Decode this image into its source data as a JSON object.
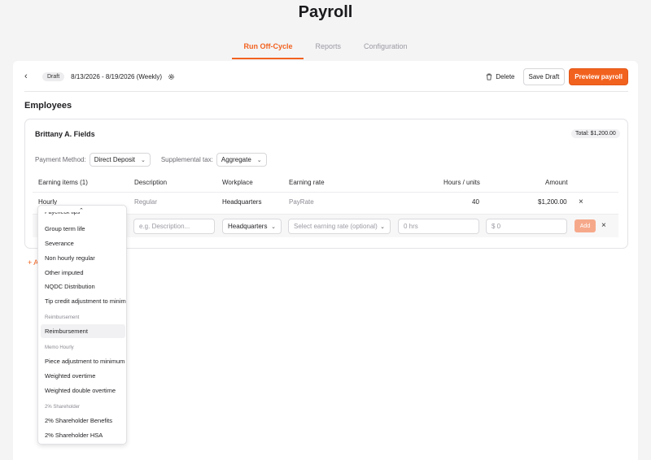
{
  "page": {
    "title": "Payroll"
  },
  "tabs": [
    {
      "label": "Run Off-Cycle"
    },
    {
      "label": "Reports"
    },
    {
      "label": "Configuration"
    }
  ],
  "toolbar": {
    "status": "Draft",
    "period": "8/13/2026 - 8/19/2026 (Weekly)",
    "delete_label": "Delete",
    "save_label": "Save Draft",
    "preview_label": "Preview payroll"
  },
  "section": {
    "title": "Employees"
  },
  "employee": {
    "name": "Brittany A. Fields",
    "total": "Total: $1,200.00",
    "payment_method_label": "Payment Method:",
    "payment_method_value": "Direct Deposit",
    "supp_tax_label": "Supplemental tax:",
    "supp_tax_value": "Aggregate"
  },
  "table": {
    "headers": [
      "Earning items (1)",
      "Description",
      "Workplace",
      "Earning rate",
      "Hours / units",
      "Amount"
    ],
    "row": {
      "item": "Hourly",
      "description": "Regular",
      "workplace": "Headquarters",
      "rate": "PayRate",
      "hours": "40",
      "amount": "$1,200.00"
    },
    "new_row": {
      "description_placeholder": "e.g. Description...",
      "workplace": "Headquarters",
      "rate_placeholder": "Select earning rate (optional)",
      "hours_placeholder": "0 hrs",
      "amount_placeholder": "$ 0",
      "add_label": "Add"
    }
  },
  "add_link": "+ A",
  "dropdown": {
    "cut_item": "Paycheck tips",
    "items_a": [
      "Group term life",
      "Severance",
      "Non hourly regular",
      "Other imputed",
      "NQDC Distribution",
      "Tip credit adjustment to minimum"
    ],
    "group_reimb": "Reimbursement",
    "item_reimb": "Reimbursement",
    "group_memo": "Memo Hourly",
    "items_memo": [
      "Piece adjustment to minimum",
      "Weighted overtime",
      "Weighted double overtime"
    ],
    "group_share": "2% Shareholder",
    "items_share": [
      "2% Shareholder Benefits",
      "2% Shareholder HSA"
    ]
  },
  "colors": {
    "accent": "#f2621f",
    "add_button": "#f6a98a"
  },
  "icons": [
    "chevron-left-icon",
    "gear-icon",
    "trash-icon",
    "chevron-down-icon",
    "close-icon",
    "chevron-up-icon"
  ]
}
